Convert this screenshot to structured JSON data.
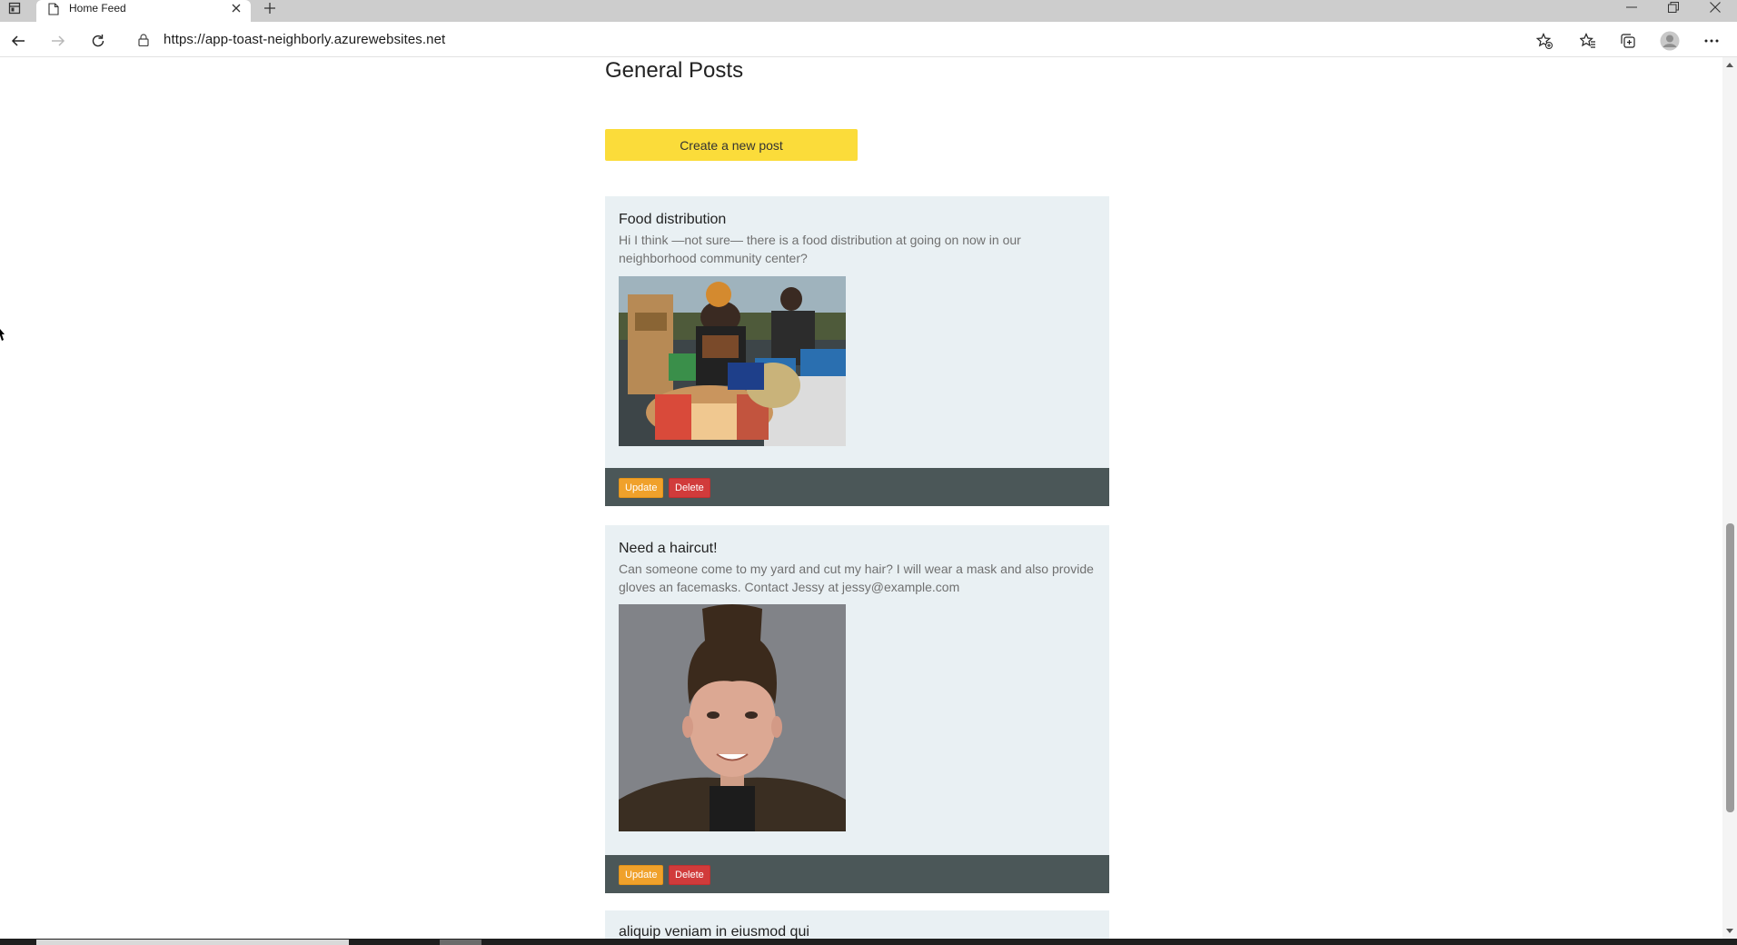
{
  "browser": {
    "tab_title": "Home Feed",
    "url": "https://app-toast-neighborly.azurewebsites.net"
  },
  "page": {
    "title": "General Posts",
    "create_button": "Create a new post"
  },
  "posts": [
    {
      "title": "Food distribution",
      "description": "Hi I think —not sure— there is a food distribution at going on now in our neighborhood community center?",
      "image": "food-distribution-photo",
      "update_label": "Update",
      "delete_label": "Delete"
    },
    {
      "title": "Need a haircut!",
      "description": "Can someone come to my yard and cut my hair? I will wear a mask and also provide gloves an facemasks. Contact Jessy at jessy@example.com",
      "image": "portrait-photo",
      "update_label": "Update",
      "delete_label": "Delete"
    },
    {
      "title": "aliquip veniam in eiusmod qui"
    }
  ],
  "colors": {
    "create_button": "#fbdc3a",
    "post_background": "#e9f0f3",
    "post_footer": "#4b5758",
    "update_button": "#f0a12b",
    "delete_button": "#d13b3b"
  },
  "icons": {
    "tab_actions": "tab-actions-icon",
    "tab_page": "page-icon",
    "tab_close": "close-icon",
    "new_tab": "plus-icon",
    "back": "back-arrow-icon",
    "forward": "forward-arrow-icon",
    "refresh": "refresh-icon",
    "lock": "lock-icon",
    "add_favorite": "add-favorite-icon",
    "favorites": "favorites-icon",
    "collections": "collections-icon",
    "profile": "profile-icon",
    "more": "more-icon"
  }
}
